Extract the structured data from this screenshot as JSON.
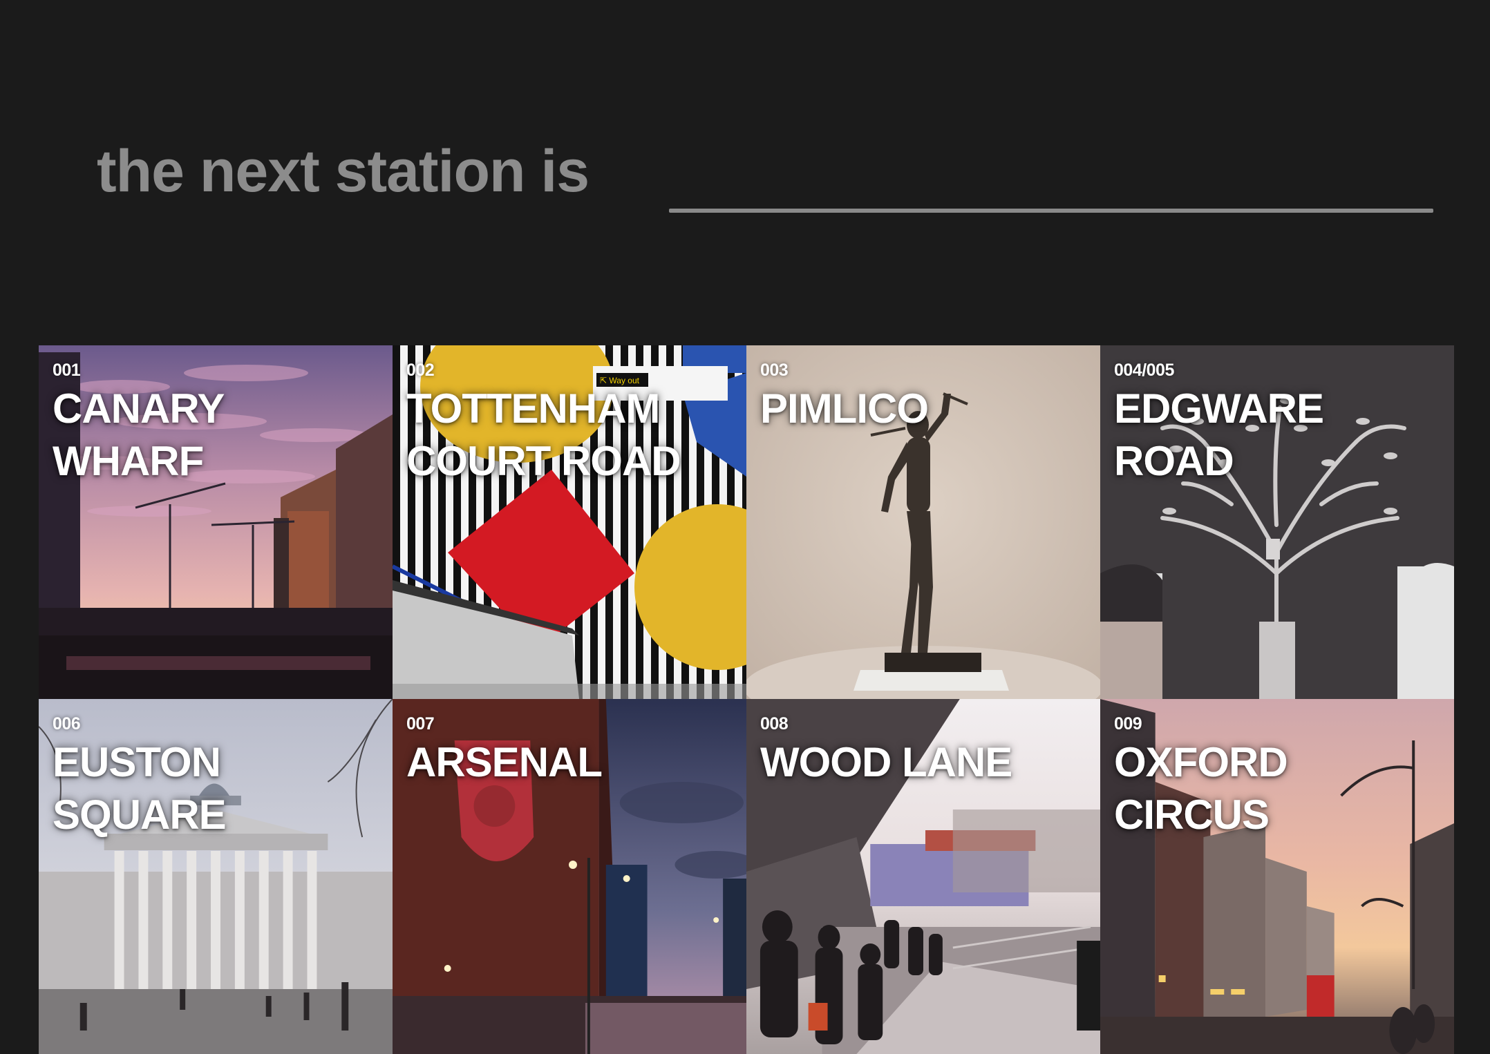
{
  "header": {
    "prompt": "the next station is",
    "answer": ""
  },
  "stations": [
    {
      "number": "001",
      "name": "CANARY WHARF",
      "image": "canary-wharf-sunset-photo"
    },
    {
      "number": "002",
      "name": "TOTTENHAM COURT ROAD",
      "image": "tottenham-court-road-mural-photo"
    },
    {
      "number": "003",
      "name": "PIMLICO",
      "image": "pimlico-statue-photo"
    },
    {
      "number": "004/005",
      "name": "EDGWARE ROAD",
      "image": "edgware-road-tree-mural-photo"
    },
    {
      "number": "006",
      "name": "EUSTON SQUARE",
      "image": "euston-square-building-photo"
    },
    {
      "number": "007",
      "name": "ARSENAL",
      "image": "arsenal-stadium-photo"
    },
    {
      "number": "008",
      "name": "WOOD LANE",
      "image": "wood-lane-street-photo"
    },
    {
      "number": "009",
      "name": "OXFORD CIRCUS",
      "image": "oxford-circus-street-photo"
    }
  ],
  "colors": {
    "background": "#1b1b1b",
    "headline": "#8c8c8c",
    "underline": "#8a8a8a",
    "tile_text": "#ffffff"
  }
}
